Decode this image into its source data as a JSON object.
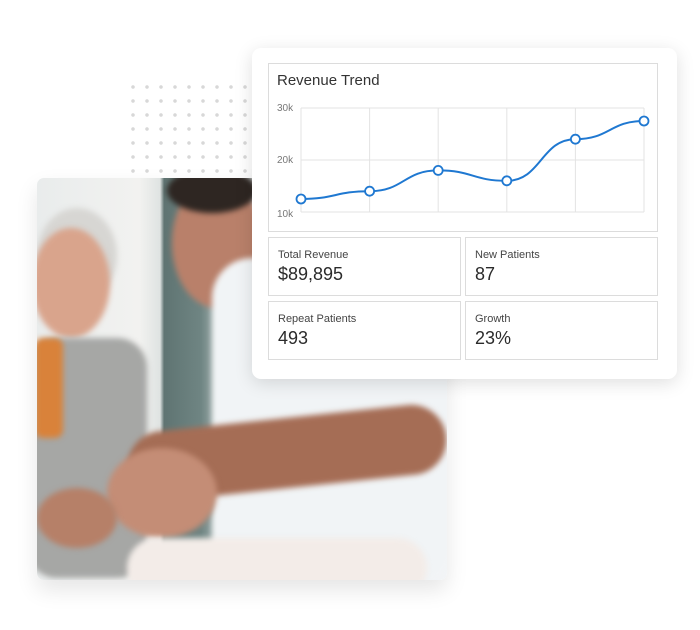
{
  "card": {
    "title": "Revenue Trend",
    "stats": [
      {
        "label": "Total Revenue",
        "value": "$89,895"
      },
      {
        "label": "New Patients",
        "value": "87"
      },
      {
        "label": "Repeat Patients",
        "value": "493"
      },
      {
        "label": "Growth",
        "value": "23%"
      }
    ]
  },
  "colors": {
    "line": "#1f78d1",
    "grid": "#e3e3e3"
  },
  "photo": {
    "description": "doctor examining senior woman's hand"
  },
  "chart_data": {
    "type": "line",
    "title": "Revenue Trend",
    "x": [
      1,
      2,
      3,
      4,
      5,
      6
    ],
    "series": [
      {
        "name": "Revenue",
        "values": [
          12500,
          14000,
          18000,
          16000,
          24000,
          27500
        ]
      }
    ],
    "yticks": [
      "30k",
      "20k",
      "10k"
    ],
    "ylim": [
      10000,
      30000
    ],
    "grid": true,
    "xlabel": "",
    "ylabel": ""
  }
}
